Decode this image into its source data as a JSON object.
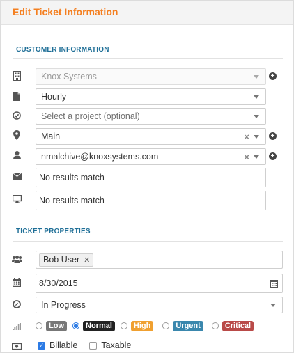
{
  "header": {
    "title": "Edit Ticket Information"
  },
  "customer_section": {
    "title": "CUSTOMER INFORMATION",
    "company": {
      "value": "Knox Systems",
      "icon": "building-icon"
    },
    "contract": {
      "value": "Hourly",
      "icon": "document-icon"
    },
    "project": {
      "placeholder": "Select a project (optional)",
      "icon": "check-circle-icon"
    },
    "location": {
      "value": "Main",
      "icon": "map-marker-icon"
    },
    "contact": {
      "value": "nmalchive@knoxsystems.com",
      "icon": "user-icon"
    },
    "email": {
      "value": "No results match",
      "icon": "envelope-icon"
    },
    "device": {
      "value": "No results match",
      "icon": "monitor-icon"
    }
  },
  "ticket_section": {
    "title": "TICKET PROPERTIES",
    "assigned": {
      "tag": "Bob User",
      "icon": "users-icon"
    },
    "date": {
      "value": "8/30/2015",
      "icon": "calendar-icon"
    },
    "status": {
      "value": "In Progress",
      "icon": "compass-icon"
    },
    "priority": {
      "icon": "signal-bars-icon",
      "options": [
        {
          "label": "Low",
          "color": "#777777",
          "checked": false
        },
        {
          "label": "Normal",
          "color": "#222222",
          "checked": true
        },
        {
          "label": "High",
          "color": "#f0a030",
          "checked": false
        },
        {
          "label": "Urgent",
          "color": "#3a87ad",
          "checked": false
        },
        {
          "label": "Critical",
          "color": "#b94a48",
          "checked": false
        }
      ]
    },
    "billing": {
      "icon": "money-icon",
      "billable": {
        "label": "Billable",
        "checked": true
      },
      "taxable": {
        "label": "Taxable",
        "checked": false
      }
    }
  }
}
